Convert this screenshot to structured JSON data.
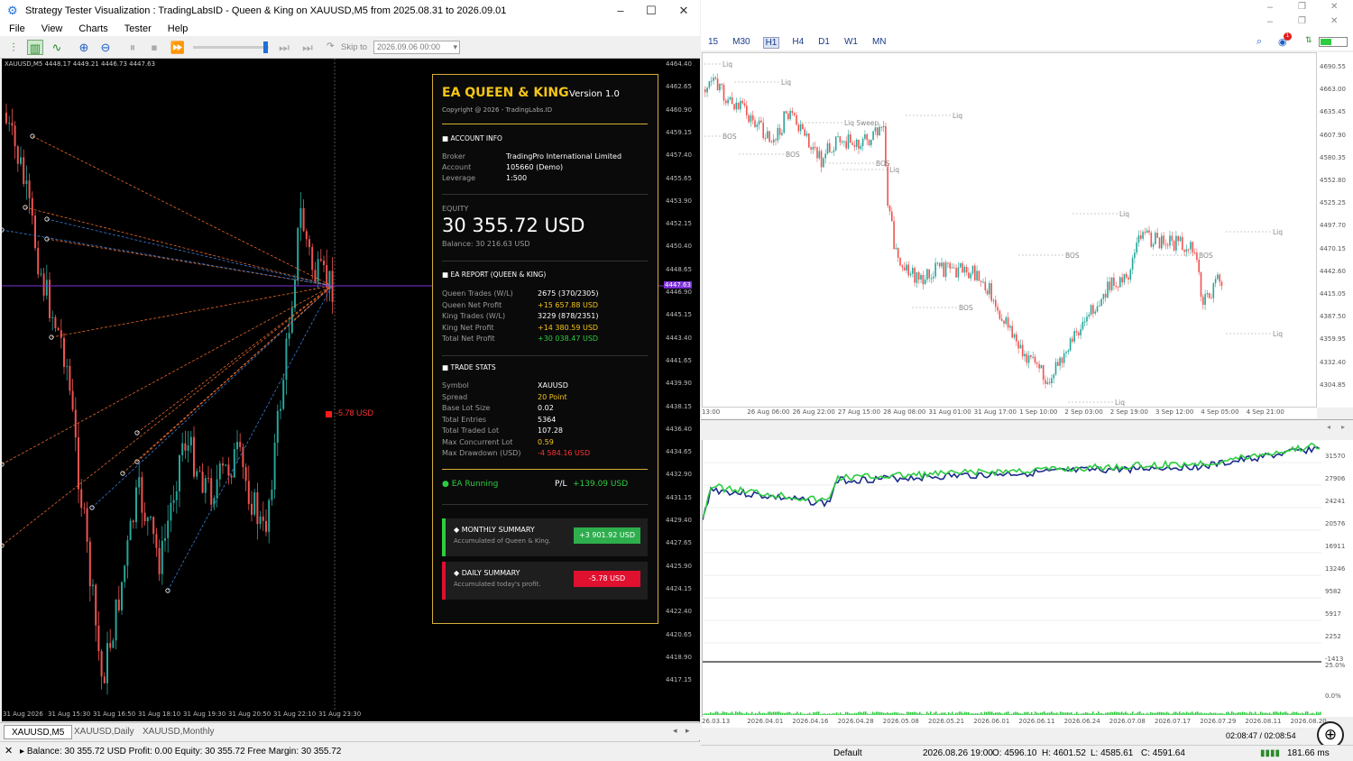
{
  "window": {
    "title": "Strategy Tester Visualization : TradingLabsID - Queen & King on XAUUSD,M5 from 2025.08.31 to 2026.09.01",
    "menu": [
      "File",
      "View",
      "Charts",
      "Tester",
      "Help"
    ],
    "skip_to_label": "Skip to",
    "skip_to_value": "2026.09.06 00:00"
  },
  "left_chart": {
    "symbol_info": "XAUUSD,M5  4448.17 4449.21 4446.73 4447.63",
    "price_ticks": [
      "4464.40",
      "4462.65",
      "4460.90",
      "4459.15",
      "4457.40",
      "4455.65",
      "4453.90",
      "4452.15",
      "4450.40",
      "4448.65",
      "4446.90",
      "4445.15",
      "4443.40",
      "4441.65",
      "4439.90",
      "4438.15",
      "4436.40",
      "4434.65",
      "4432.90",
      "4431.15",
      "4429.40",
      "4427.65",
      "4425.90",
      "4424.15",
      "4422.40",
      "4420.65",
      "4418.90",
      "4417.15"
    ],
    "current_price": "4447.63",
    "time_ticks": [
      "31 Aug 2026",
      "31 Aug 15:30",
      "31 Aug 16:50",
      "31 Aug 18:10",
      "31 Aug 19:30",
      "31 Aug 20:50",
      "31 Aug 22:10",
      "31 Aug 23:30"
    ],
    "loss_label": "-5.78 USD",
    "tabs": [
      "XAUUSD,M5",
      "XAUUSD,Daily",
      "XAUUSD,Monthly"
    ],
    "status": "Balance: 30 355.72 USD  Profit: 0.00  Equity: 30 355.72  Free Margin: 30 355.72"
  },
  "panel": {
    "title": "EA QUEEN & KING",
    "version": "Version 1.0",
    "copyright": "Copyright @ 2026 - TradingLabs.ID",
    "account_header": "ACCOUNT INFO",
    "account": [
      {
        "label": "Broker",
        "value": "TradingPro International Limited"
      },
      {
        "label": "Account",
        "value": "105660 (Demo)"
      },
      {
        "label": "Leverage",
        "value": "1:500"
      }
    ],
    "equity_label": "EQUITY",
    "equity_value": "30 355.72 USD",
    "balance": "Balance: 30 216.63 USD",
    "report_header": "EA REPORT (QUEEN & KING)",
    "report": [
      {
        "label": "Queen Trades (W/L)",
        "value": "2675 (370/2305)",
        "color": "#ffffff"
      },
      {
        "label": "Queen Net Profit",
        "value": "+15 657.88 USD",
        "color": "#f5c518"
      },
      {
        "label": "King Trades (W/L)",
        "value": "3229 (878/2351)",
        "color": "#ffffff"
      },
      {
        "label": "King Net Profit",
        "value": "+14 380.59 USD",
        "color": "#f5c518"
      },
      {
        "label": "Total Net Profit",
        "value": "+30 038.47 USD",
        "color": "#2ecc40"
      }
    ],
    "stats_header": "TRADE STATS",
    "stats": [
      {
        "label": "Symbol",
        "value": "XAUUSD",
        "color": "#ffffff"
      },
      {
        "label": "Spread",
        "value": "20 Point",
        "color": "#f5c518"
      },
      {
        "label": "Base Lot Size",
        "value": "0.02",
        "color": "#ffffff"
      },
      {
        "label": "Total Entries",
        "value": "5364",
        "color": "#ffffff"
      },
      {
        "label": "Total Traded Lot",
        "value": "107.28",
        "color": "#ffffff"
      },
      {
        "label": "Max Concurrent Lot",
        "value": "0.59",
        "color": "#f5c518"
      },
      {
        "label": "Max Drawdown (USD)",
        "value": "-4 584.16 USD",
        "color": "#ff3333"
      }
    ],
    "status_running": "EA Running",
    "pl_label": "P/L",
    "pl_value": "+139.09 USD",
    "monthly_title": "MONTHLY SUMMARY",
    "monthly_sub": "Accumulated of Queen & King.",
    "monthly_value": "+3 901.92 USD",
    "daily_title": "DAILY SUMMARY",
    "daily_sub": "Accumulated today's profit.",
    "daily_value": "-5.78 USD"
  },
  "right_chart": {
    "timeframes": [
      "15",
      "M30",
      "H1",
      "H4",
      "D1",
      "W1",
      "MN"
    ],
    "selected_timeframe": "H1",
    "alert_count": "1",
    "price_ticks": [
      "4690.55",
      "4663.00",
      "4635.45",
      "4607.90",
      "4580.35",
      "4552.80",
      "4525.25",
      "4497.70",
      "4470.15",
      "4442.60",
      "4415.05",
      "4387.50",
      "4359.95",
      "4332.40",
      "4304.85"
    ],
    "time_ticks": [
      "13:00",
      "26 Aug 06:00",
      "26 Aug 22:00",
      "27 Aug 15:00",
      "28 Aug 08:00",
      "31 Aug 01:00",
      "31 Aug 17:00",
      "1 Sep 10:00",
      "2 Sep 03:00",
      "2 Sep 19:00",
      "3 Sep 12:00",
      "4 Sep 05:00",
      "4 Sep 21:00"
    ],
    "annotations": [
      "Liq",
      "Liq",
      "Liq",
      "Liq Sweep",
      "BOS",
      "BOS",
      "BOS",
      "Liq",
      "BOS",
      "BOS",
      "Liq",
      "Liq",
      "BOS",
      "Liq",
      "Liq"
    ]
  },
  "equity_chart": {
    "y_ticks": [
      "31570",
      "27906",
      "24241",
      "20576",
      "16911",
      "13246",
      "9582",
      "5917",
      "2252",
      "-1413"
    ],
    "pct_ticks": [
      "25.0%",
      "0.0%"
    ],
    "time_ticks": [
      "26.03.13",
      "2026.04.01",
      "2026.04.16",
      "2026.04.28",
      "2026.05.08",
      "2026.05.21",
      "2026.06.01",
      "2026.06.11",
      "2026.06.24",
      "2026.07.08",
      "2026.07.17",
      "2026.07.29",
      "2026.08.11",
      "2026.08.20"
    ],
    "timer": "02:08:47 / 02:08:54"
  },
  "status_bar": {
    "profile": "Default",
    "datetime": "2026.08.26 19:00",
    "open": "O: 4596.10",
    "high": "H: 4601.52",
    "low": "L: 4585.61",
    "close": "C: 4591.64",
    "ping": "181.66 ms"
  },
  "colors": {
    "gold": "#d4af37",
    "profit_green": "#2ecc40",
    "loss_red": "#e0102f",
    "bull_candle": "#26a69a",
    "bear_candle": "#ef5350"
  }
}
